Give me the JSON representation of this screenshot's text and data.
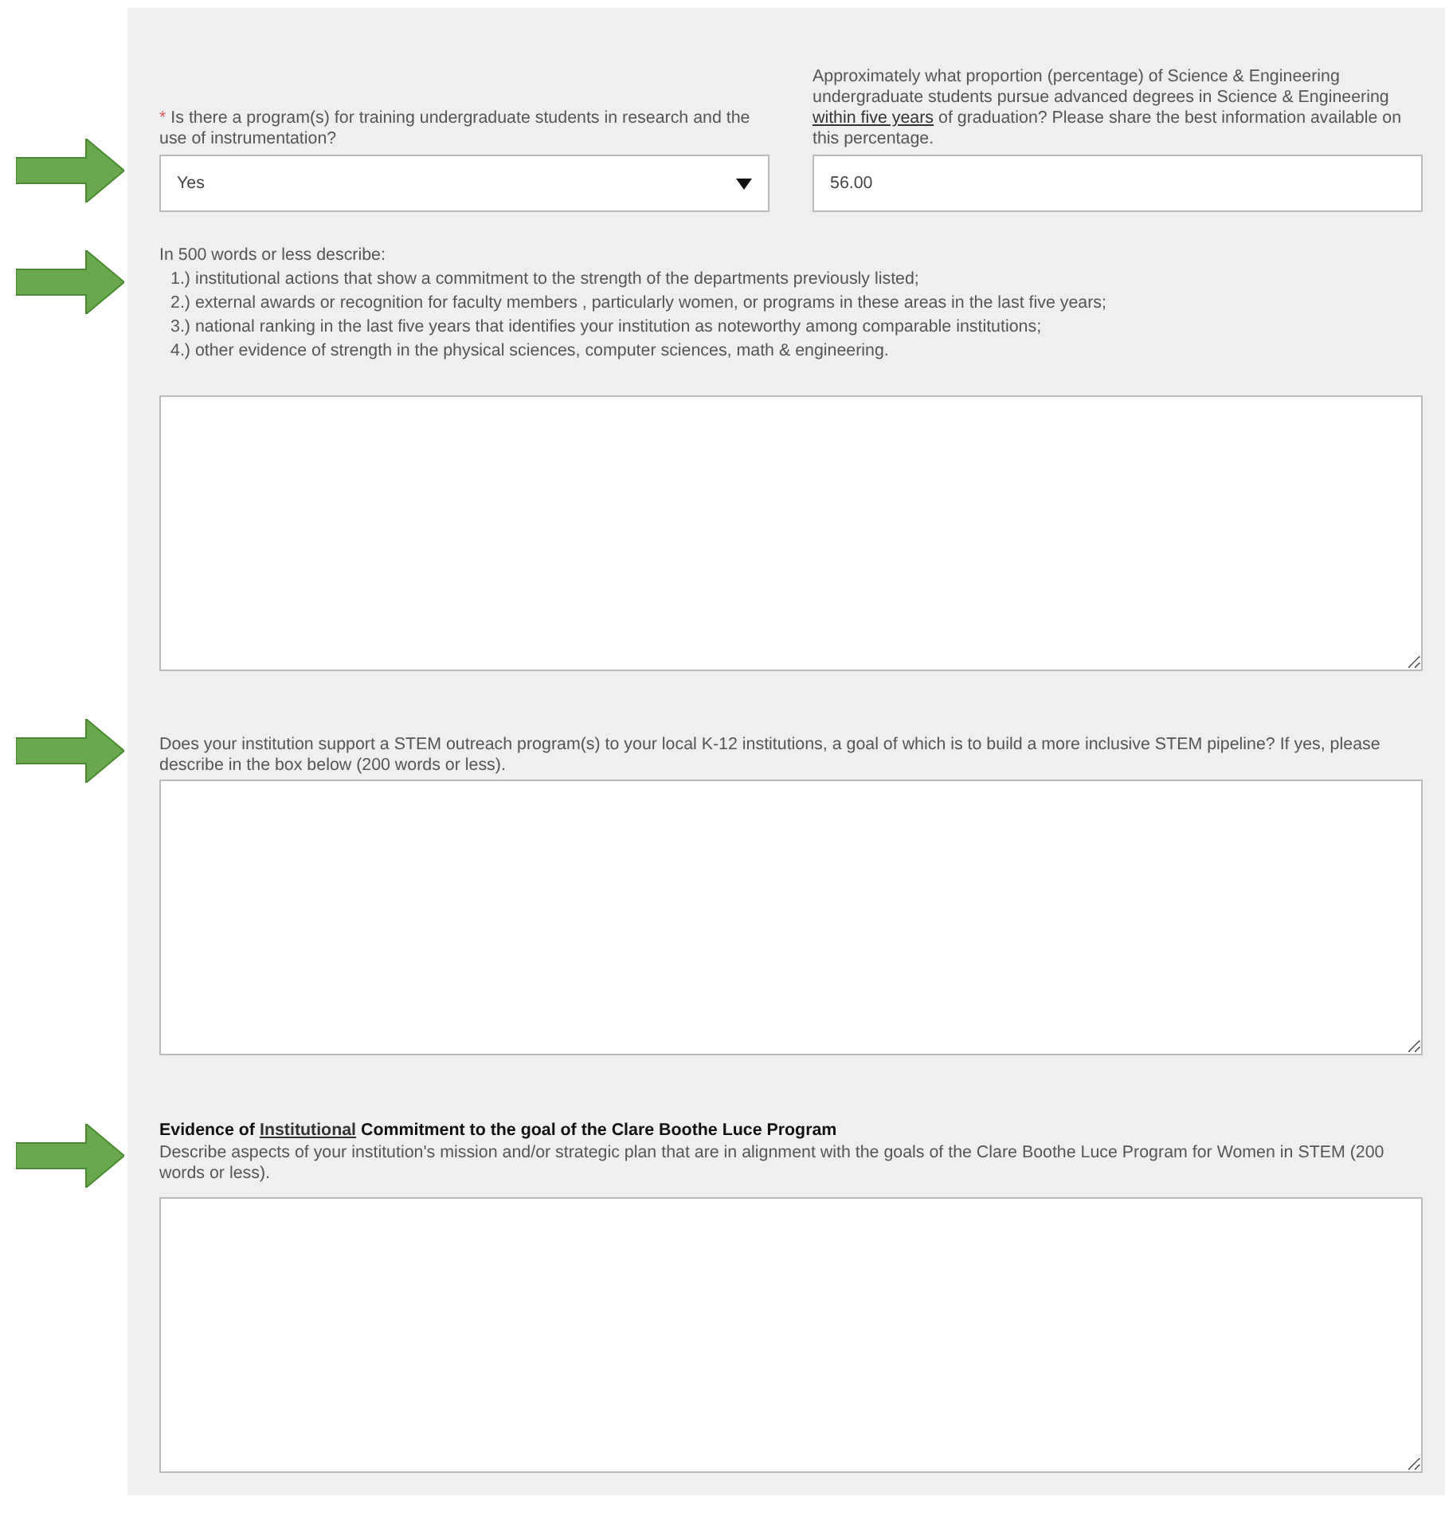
{
  "sections": [
    {
      "kind": "pair",
      "marked": true,
      "questions": [
        {
          "required_mark": "*",
          "label": [
            {
              "text": "Is there a program(s) for training undergraduate students in research and the use of instrumentation?",
              "underline": false
            }
          ],
          "field": {
            "kind": "select",
            "value": "Yes"
          }
        },
        {
          "label": [
            {
              "text": "Approximately what proportion (percentage) of Science & Engineering undergraduate students pursue advanced degrees in Science & Engineering ",
              "underline": false
            },
            {
              "text": "within five years",
              "underline": true
            },
            {
              "text": " of graduation? Please share the best information available on this percentage.",
              "underline": false
            }
          ],
          "field": {
            "kind": "text",
            "value": "56.00"
          }
        }
      ]
    },
    {
      "kind": "list",
      "marked": true,
      "intro": "In 500 words or less describe:",
      "items": [
        "1.) institutional actions that show a commitment to the strength of the departments previously listed;",
        "2.) external awards or recognition for faculty members , particularly women, or programs in these areas in the last five years;",
        "3.) national ranking in the last five years that identifies your institution as noteworthy among comparable institutions;",
        "4.) other evidence of strength in the physical sciences, computer sciences, math & engineering."
      ]
    },
    {
      "kind": "text",
      "marked": true,
      "description": "Does your institution support a STEM outreach program(s) to your local K-12 institutions, a goal of which is to build a more inclusive STEM pipeline? If yes, please describe in the box below (200 words or less)."
    },
    {
      "kind": "titled",
      "marked": true,
      "title": [
        {
          "text": "Evidence of ",
          "underline": false
        },
        {
          "text": "Institutional",
          "underline": true
        },
        {
          "text": " Commitment to the goal of the Clare Boothe Luce Program",
          "underline": false
        }
      ],
      "description": "Describe aspects of your institution's mission and/or strategic plan that are in alignment with the goals of the Clare Boothe Luce Program for Women in STEM (200 words or less)."
    }
  ]
}
